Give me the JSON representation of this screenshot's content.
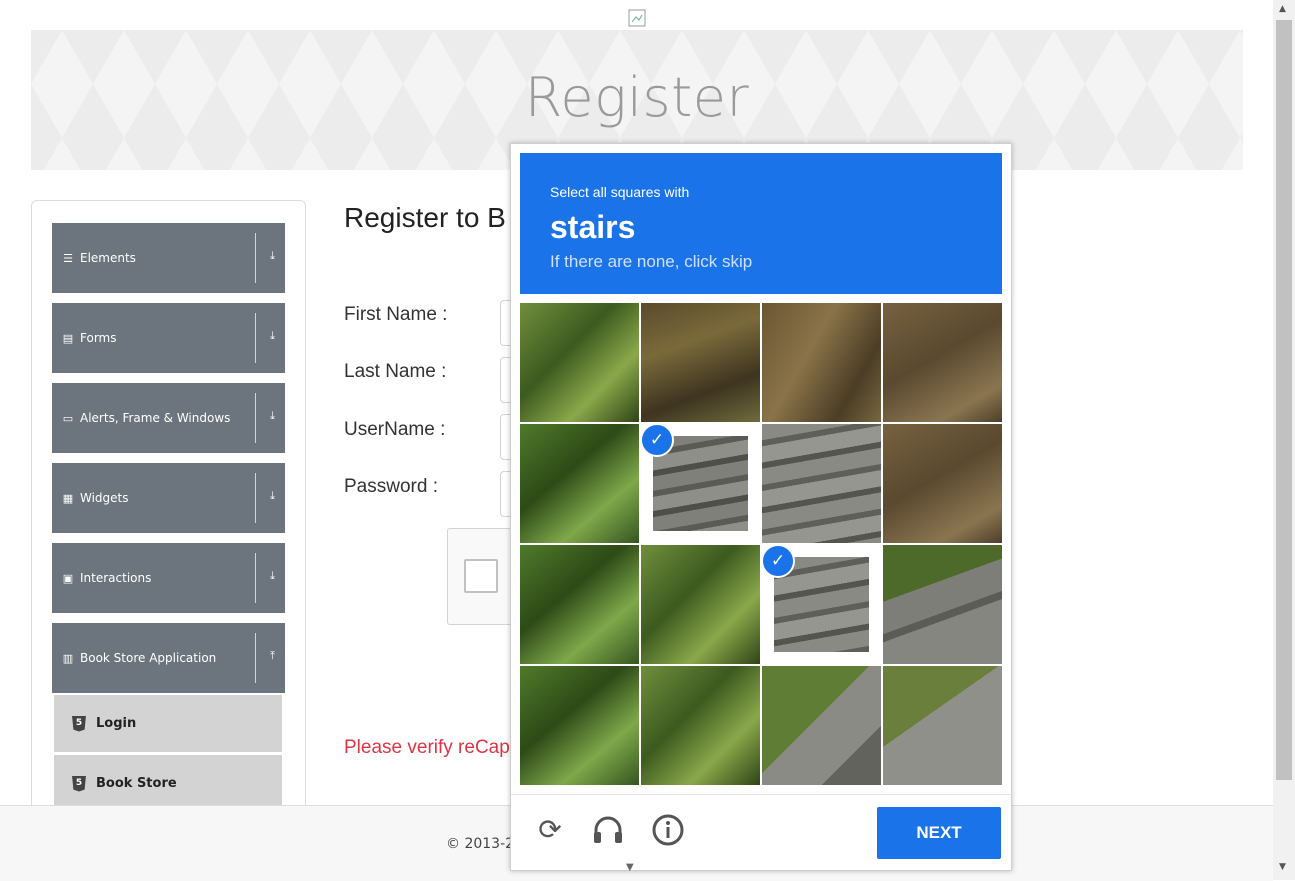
{
  "page": {
    "banner_title": "Register",
    "form_title": "Register to B",
    "fields": [
      {
        "label": "First Name :"
      },
      {
        "label": "Last Name :"
      },
      {
        "label": "UserName :"
      },
      {
        "label": "Password :"
      }
    ],
    "warning": "Please verify reCap",
    "footer": "© 2013-2"
  },
  "sidebar": {
    "groups": [
      {
        "label": "Elements",
        "icon": "menu-icon",
        "arrow": "download-icon"
      },
      {
        "label": "Forms",
        "icon": "forms-icon",
        "arrow": "download-icon"
      },
      {
        "label": "Alerts, Frame & Windows",
        "icon": "window-icon",
        "arrow": "download-icon"
      },
      {
        "label": "Widgets",
        "icon": "widgets-icon",
        "arrow": "download-icon"
      },
      {
        "label": "Interactions",
        "icon": "interactions-icon",
        "arrow": "download-icon"
      },
      {
        "label": "Book Store Application",
        "icon": "books-icon",
        "arrow": "upload-icon"
      }
    ],
    "subitems": [
      {
        "label": "Login"
      },
      {
        "label": "Book Store"
      }
    ]
  },
  "captcha": {
    "instruction": "Select all squares with",
    "target": "stairs",
    "hint": "If there are none, click skip",
    "tiles_selected": [
      5,
      10
    ],
    "next_label": "NEXT",
    "accent": "#1a73e8"
  }
}
